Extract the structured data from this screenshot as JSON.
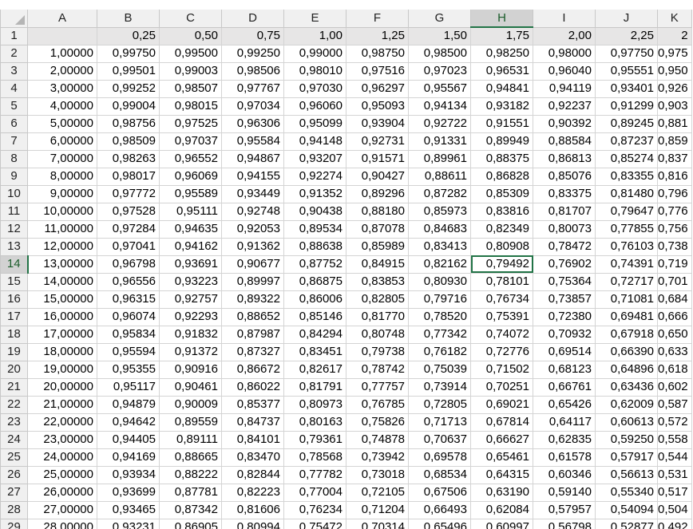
{
  "columns": [
    "A",
    "B",
    "C",
    "D",
    "E",
    "F",
    "G",
    "H",
    "I",
    "J",
    "K"
  ],
  "selected_column": "H",
  "selected_row": "14",
  "header_row": {
    "row": "1",
    "cells": [
      "",
      "0,25",
      "0,50",
      "0,75",
      "1,00",
      "1,25",
      "1,50",
      "1,75",
      "2,00",
      "2,25",
      "2"
    ]
  },
  "rows": [
    {
      "row": "2",
      "cells": [
        "1,00000",
        "0,99750",
        "0,99500",
        "0,99250",
        "0,99000",
        "0,98750",
        "0,98500",
        "0,98250",
        "0,98000",
        "0,97750",
        "0,975"
      ]
    },
    {
      "row": "3",
      "cells": [
        "2,00000",
        "0,99501",
        "0,99003",
        "0,98506",
        "0,98010",
        "0,97516",
        "0,97023",
        "0,96531",
        "0,96040",
        "0,95551",
        "0,950"
      ]
    },
    {
      "row": "4",
      "cells": [
        "3,00000",
        "0,99252",
        "0,98507",
        "0,97767",
        "0,97030",
        "0,96297",
        "0,95567",
        "0,94841",
        "0,94119",
        "0,93401",
        "0,926"
      ]
    },
    {
      "row": "5",
      "cells": [
        "4,00000",
        "0,99004",
        "0,98015",
        "0,97034",
        "0,96060",
        "0,95093",
        "0,94134",
        "0,93182",
        "0,92237",
        "0,91299",
        "0,903"
      ]
    },
    {
      "row": "6",
      "cells": [
        "5,00000",
        "0,98756",
        "0,97525",
        "0,96306",
        "0,95099",
        "0,93904",
        "0,92722",
        "0,91551",
        "0,90392",
        "0,89245",
        "0,881"
      ]
    },
    {
      "row": "7",
      "cells": [
        "6,00000",
        "0,98509",
        "0,97037",
        "0,95584",
        "0,94148",
        "0,92731",
        "0,91331",
        "0,89949",
        "0,88584",
        "0,87237",
        "0,859"
      ]
    },
    {
      "row": "8",
      "cells": [
        "7,00000",
        "0,98263",
        "0,96552",
        "0,94867",
        "0,93207",
        "0,91571",
        "0,89961",
        "0,88375",
        "0,86813",
        "0,85274",
        "0,837"
      ]
    },
    {
      "row": "9",
      "cells": [
        "8,00000",
        "0,98017",
        "0,96069",
        "0,94155",
        "0,92274",
        "0,90427",
        "0,88611",
        "0,86828",
        "0,85076",
        "0,83355",
        "0,816"
      ]
    },
    {
      "row": "10",
      "cells": [
        "9,00000",
        "0,97772",
        "0,95589",
        "0,93449",
        "0,91352",
        "0,89296",
        "0,87282",
        "0,85309",
        "0,83375",
        "0,81480",
        "0,796"
      ]
    },
    {
      "row": "11",
      "cells": [
        "10,00000",
        "0,97528",
        "0,95111",
        "0,92748",
        "0,90438",
        "0,88180",
        "0,85973",
        "0,83816",
        "0,81707",
        "0,79647",
        "0,776"
      ]
    },
    {
      "row": "12",
      "cells": [
        "11,00000",
        "0,97284",
        "0,94635",
        "0,92053",
        "0,89534",
        "0,87078",
        "0,84683",
        "0,82349",
        "0,80073",
        "0,77855",
        "0,756"
      ]
    },
    {
      "row": "13",
      "cells": [
        "12,00000",
        "0,97041",
        "0,94162",
        "0,91362",
        "0,88638",
        "0,85989",
        "0,83413",
        "0,80908",
        "0,78472",
        "0,76103",
        "0,738"
      ]
    },
    {
      "row": "14",
      "cells": [
        "13,00000",
        "0,96798",
        "0,93691",
        "0,90677",
        "0,87752",
        "0,84915",
        "0,82162",
        "0,79492",
        "0,76902",
        "0,74391",
        "0,719"
      ]
    },
    {
      "row": "15",
      "cells": [
        "14,00000",
        "0,96556",
        "0,93223",
        "0,89997",
        "0,86875",
        "0,83853",
        "0,80930",
        "0,78101",
        "0,75364",
        "0,72717",
        "0,701"
      ]
    },
    {
      "row": "16",
      "cells": [
        "15,00000",
        "0,96315",
        "0,92757",
        "0,89322",
        "0,86006",
        "0,82805",
        "0,79716",
        "0,76734",
        "0,73857",
        "0,71081",
        "0,684"
      ]
    },
    {
      "row": "17",
      "cells": [
        "16,00000",
        "0,96074",
        "0,92293",
        "0,88652",
        "0,85146",
        "0,81770",
        "0,78520",
        "0,75391",
        "0,72380",
        "0,69481",
        "0,666"
      ]
    },
    {
      "row": "18",
      "cells": [
        "17,00000",
        "0,95834",
        "0,91832",
        "0,87987",
        "0,84294",
        "0,80748",
        "0,77342",
        "0,74072",
        "0,70932",
        "0,67918",
        "0,650"
      ]
    },
    {
      "row": "19",
      "cells": [
        "18,00000",
        "0,95594",
        "0,91372",
        "0,87327",
        "0,83451",
        "0,79738",
        "0,76182",
        "0,72776",
        "0,69514",
        "0,66390",
        "0,633"
      ]
    },
    {
      "row": "20",
      "cells": [
        "19,00000",
        "0,95355",
        "0,90916",
        "0,86672",
        "0,82617",
        "0,78742",
        "0,75039",
        "0,71502",
        "0,68123",
        "0,64896",
        "0,618"
      ]
    },
    {
      "row": "21",
      "cells": [
        "20,00000",
        "0,95117",
        "0,90461",
        "0,86022",
        "0,81791",
        "0,77757",
        "0,73914",
        "0,70251",
        "0,66761",
        "0,63436",
        "0,602"
      ]
    },
    {
      "row": "22",
      "cells": [
        "21,00000",
        "0,94879",
        "0,90009",
        "0,85377",
        "0,80973",
        "0,76785",
        "0,72805",
        "0,69021",
        "0,65426",
        "0,62009",
        "0,587"
      ]
    },
    {
      "row": "23",
      "cells": [
        "22,00000",
        "0,94642",
        "0,89559",
        "0,84737",
        "0,80163",
        "0,75826",
        "0,71713",
        "0,67814",
        "0,64117",
        "0,60613",
        "0,572"
      ]
    },
    {
      "row": "24",
      "cells": [
        "23,00000",
        "0,94405",
        "0,89111",
        "0,84101",
        "0,79361",
        "0,74878",
        "0,70637",
        "0,66627",
        "0,62835",
        "0,59250",
        "0,558"
      ]
    },
    {
      "row": "25",
      "cells": [
        "24,00000",
        "0,94169",
        "0,88665",
        "0,83470",
        "0,78568",
        "0,73942",
        "0,69578",
        "0,65461",
        "0,61578",
        "0,57917",
        "0,544"
      ]
    },
    {
      "row": "26",
      "cells": [
        "25,00000",
        "0,93934",
        "0,88222",
        "0,82844",
        "0,77782",
        "0,73018",
        "0,68534",
        "0,64315",
        "0,60346",
        "0,56613",
        "0,531"
      ]
    },
    {
      "row": "27",
      "cells": [
        "26,00000",
        "0,93699",
        "0,87781",
        "0,82223",
        "0,77004",
        "0,72105",
        "0,67506",
        "0,63190",
        "0,59140",
        "0,55340",
        "0,517"
      ]
    },
    {
      "row": "28",
      "cells": [
        "27,00000",
        "0,93465",
        "0,87342",
        "0,81606",
        "0,76234",
        "0,71204",
        "0,66493",
        "0,62084",
        "0,57957",
        "0,54094",
        "0,504"
      ]
    },
    {
      "row": "29",
      "cells": [
        "28,00000",
        "0,93231",
        "0,86905",
        "0,80994",
        "0,75472",
        "0,70314",
        "0,65496",
        "0,60997",
        "0,56798",
        "0,52877",
        "0,492"
      ]
    }
  ]
}
